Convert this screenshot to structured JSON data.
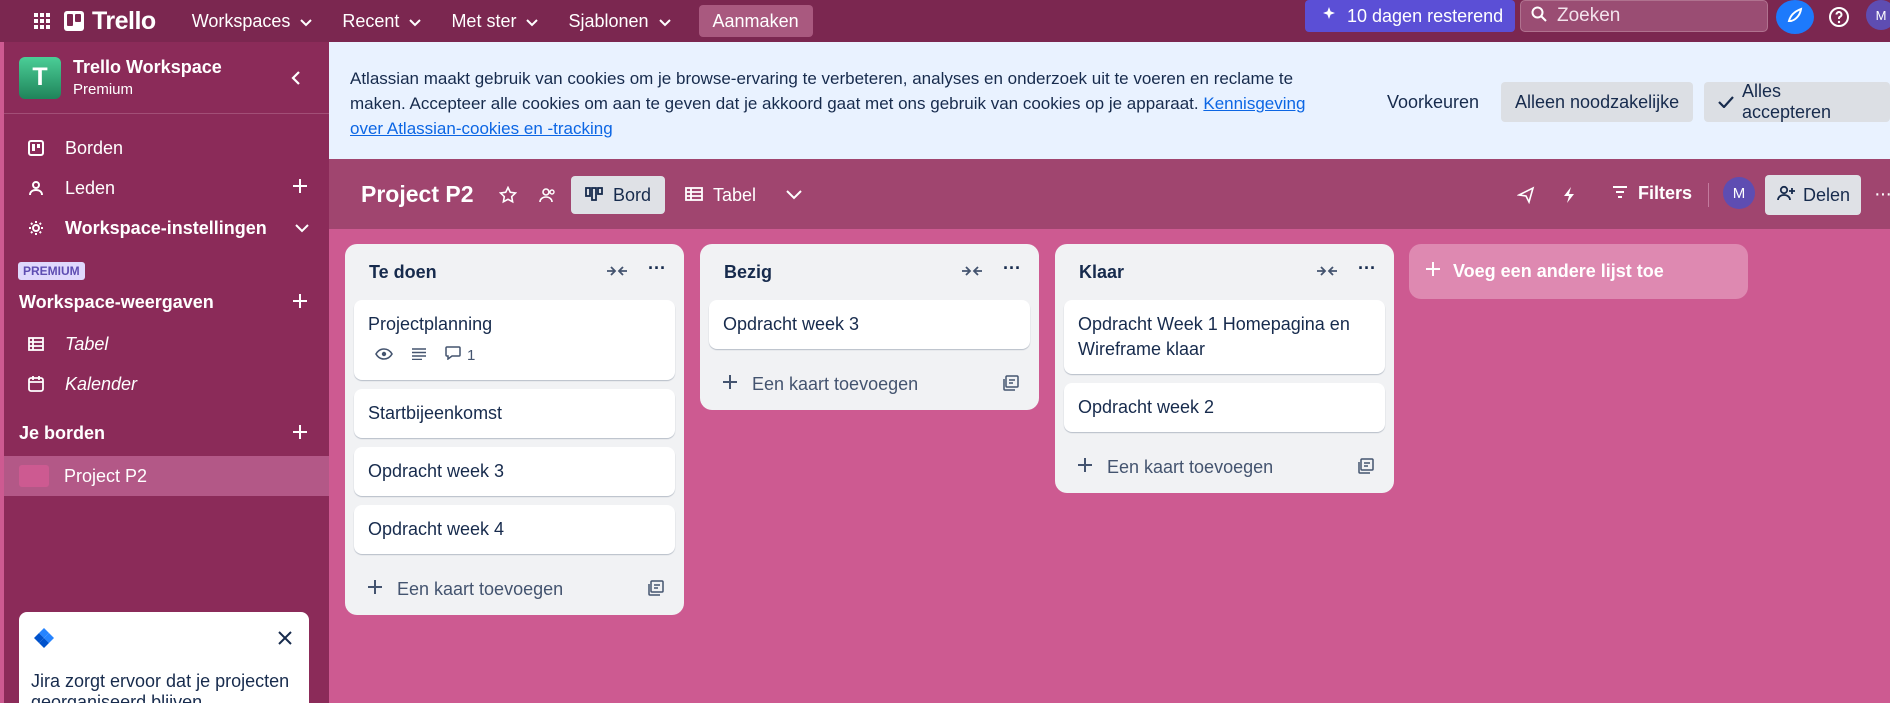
{
  "topbar": {
    "logo_text": "Trello",
    "nav": [
      "Workspaces",
      "Recent",
      "Met ster",
      "Sjablonen"
    ],
    "create_label": "Aanmaken",
    "trial_label": "10 dagen resterend",
    "search_placeholder": "Zoeken",
    "avatar_initial": "M"
  },
  "sidebar": {
    "workspace_name": "Trello Workspace",
    "workspace_plan": "Premium",
    "workspace_initial": "T",
    "items": [
      {
        "label": "Borden",
        "icon": "board-icon"
      },
      {
        "label": "Leden",
        "icon": "person-icon"
      },
      {
        "label": "Workspace-instellingen",
        "icon": "gear-icon"
      }
    ],
    "premium_badge": "PREMIUM",
    "views_title": "Workspace-weergaven",
    "views": [
      {
        "label": "Tabel",
        "icon": "table-icon"
      },
      {
        "label": "Kalender",
        "icon": "calendar-icon"
      }
    ],
    "boards_title": "Je borden",
    "boards": [
      {
        "label": "Project P2",
        "color": "#cd5a91"
      }
    ],
    "jira_promo": "Jira zorgt ervoor dat je projecten georganiseerd blijven"
  },
  "cookie_banner": {
    "text": "Atlassian maakt gebruik van cookies om je browse-ervaring te verbeteren, analyses en onderzoek uit te voeren en reclame te maken. Accepteer alle cookies om aan te geven dat je akkoord gaat met ons gebruik van cookies op je apparaat. ",
    "link_text": "Kennisgeving over Atlassian-cookies en -tracking",
    "preferences": "Voorkeuren",
    "necessary_only": "Alleen noodzakelijke",
    "accept_all": "Alles accepteren"
  },
  "board": {
    "title": "Project P2",
    "views": [
      "Bord",
      "Tabel"
    ],
    "filters_label": "Filters",
    "member_initial": "M",
    "share_label": "Delen",
    "lists": [
      {
        "title": "Te doen",
        "cards": [
          {
            "title": "Projectplanning",
            "badges": {
              "watching": true,
              "description": true,
              "comments": "1"
            }
          },
          {
            "title": "Startbijeenkomst"
          },
          {
            "title": "Opdracht week 3"
          },
          {
            "title": "Opdracht week 4"
          }
        ],
        "add_label": "Een kaart toevoegen"
      },
      {
        "title": "Bezig",
        "cards": [
          {
            "title": "Opdracht week 3"
          }
        ],
        "add_label": "Een kaart toevoegen"
      },
      {
        "title": "Klaar",
        "cards": [
          {
            "title": "Opdracht Week 1 Homepagina en Wireframe klaar"
          },
          {
            "title": "Opdracht week 2"
          }
        ],
        "add_label": "Een kaart toevoegen"
      }
    ],
    "add_list_label": "Voeg een andere lijst toe"
  },
  "colors": {
    "topbar": "#7b2750",
    "sidebar": "#8b2b59",
    "board_bg": "#cd5a91",
    "board_header": "#a0456f",
    "list_bg": "#f1f2f4",
    "primary": "#0c66e4",
    "trial": "#5b4fd6"
  }
}
